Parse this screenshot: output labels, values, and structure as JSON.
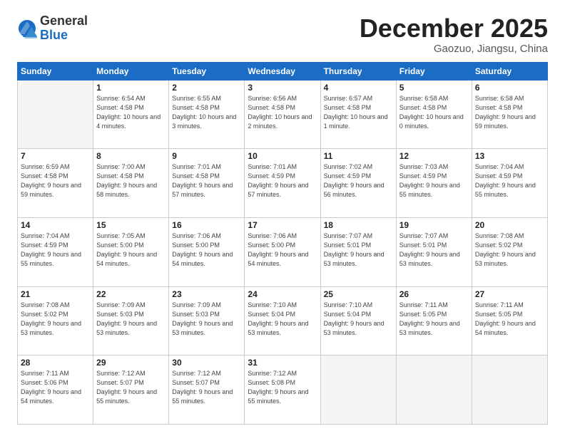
{
  "logo": {
    "general": "General",
    "blue": "Blue"
  },
  "header": {
    "month": "December 2025",
    "location": "Gaozuo, Jiangsu, China"
  },
  "weekdays": [
    "Sunday",
    "Monday",
    "Tuesday",
    "Wednesday",
    "Thursday",
    "Friday",
    "Saturday"
  ],
  "weeks": [
    [
      {
        "day": "",
        "sunrise": "",
        "sunset": "",
        "daylight": ""
      },
      {
        "day": "1",
        "sunrise": "Sunrise: 6:54 AM",
        "sunset": "Sunset: 4:58 PM",
        "daylight": "Daylight: 10 hours and 4 minutes."
      },
      {
        "day": "2",
        "sunrise": "Sunrise: 6:55 AM",
        "sunset": "Sunset: 4:58 PM",
        "daylight": "Daylight: 10 hours and 3 minutes."
      },
      {
        "day": "3",
        "sunrise": "Sunrise: 6:56 AM",
        "sunset": "Sunset: 4:58 PM",
        "daylight": "Daylight: 10 hours and 2 minutes."
      },
      {
        "day": "4",
        "sunrise": "Sunrise: 6:57 AM",
        "sunset": "Sunset: 4:58 PM",
        "daylight": "Daylight: 10 hours and 1 minute."
      },
      {
        "day": "5",
        "sunrise": "Sunrise: 6:58 AM",
        "sunset": "Sunset: 4:58 PM",
        "daylight": "Daylight: 10 hours and 0 minutes."
      },
      {
        "day": "6",
        "sunrise": "Sunrise: 6:58 AM",
        "sunset": "Sunset: 4:58 PM",
        "daylight": "Daylight: 9 hours and 59 minutes."
      }
    ],
    [
      {
        "day": "7",
        "sunrise": "Sunrise: 6:59 AM",
        "sunset": "Sunset: 4:58 PM",
        "daylight": "Daylight: 9 hours and 59 minutes."
      },
      {
        "day": "8",
        "sunrise": "Sunrise: 7:00 AM",
        "sunset": "Sunset: 4:58 PM",
        "daylight": "Daylight: 9 hours and 58 minutes."
      },
      {
        "day": "9",
        "sunrise": "Sunrise: 7:01 AM",
        "sunset": "Sunset: 4:58 PM",
        "daylight": "Daylight: 9 hours and 57 minutes."
      },
      {
        "day": "10",
        "sunrise": "Sunrise: 7:01 AM",
        "sunset": "Sunset: 4:59 PM",
        "daylight": "Daylight: 9 hours and 57 minutes."
      },
      {
        "day": "11",
        "sunrise": "Sunrise: 7:02 AM",
        "sunset": "Sunset: 4:59 PM",
        "daylight": "Daylight: 9 hours and 56 minutes."
      },
      {
        "day": "12",
        "sunrise": "Sunrise: 7:03 AM",
        "sunset": "Sunset: 4:59 PM",
        "daylight": "Daylight: 9 hours and 55 minutes."
      },
      {
        "day": "13",
        "sunrise": "Sunrise: 7:04 AM",
        "sunset": "Sunset: 4:59 PM",
        "daylight": "Daylight: 9 hours and 55 minutes."
      }
    ],
    [
      {
        "day": "14",
        "sunrise": "Sunrise: 7:04 AM",
        "sunset": "Sunset: 4:59 PM",
        "daylight": "Daylight: 9 hours and 55 minutes."
      },
      {
        "day": "15",
        "sunrise": "Sunrise: 7:05 AM",
        "sunset": "Sunset: 5:00 PM",
        "daylight": "Daylight: 9 hours and 54 minutes."
      },
      {
        "day": "16",
        "sunrise": "Sunrise: 7:06 AM",
        "sunset": "Sunset: 5:00 PM",
        "daylight": "Daylight: 9 hours and 54 minutes."
      },
      {
        "day": "17",
        "sunrise": "Sunrise: 7:06 AM",
        "sunset": "Sunset: 5:00 PM",
        "daylight": "Daylight: 9 hours and 54 minutes."
      },
      {
        "day": "18",
        "sunrise": "Sunrise: 7:07 AM",
        "sunset": "Sunset: 5:01 PM",
        "daylight": "Daylight: 9 hours and 53 minutes."
      },
      {
        "day": "19",
        "sunrise": "Sunrise: 7:07 AM",
        "sunset": "Sunset: 5:01 PM",
        "daylight": "Daylight: 9 hours and 53 minutes."
      },
      {
        "day": "20",
        "sunrise": "Sunrise: 7:08 AM",
        "sunset": "Sunset: 5:02 PM",
        "daylight": "Daylight: 9 hours and 53 minutes."
      }
    ],
    [
      {
        "day": "21",
        "sunrise": "Sunrise: 7:08 AM",
        "sunset": "Sunset: 5:02 PM",
        "daylight": "Daylight: 9 hours and 53 minutes."
      },
      {
        "day": "22",
        "sunrise": "Sunrise: 7:09 AM",
        "sunset": "Sunset: 5:03 PM",
        "daylight": "Daylight: 9 hours and 53 minutes."
      },
      {
        "day": "23",
        "sunrise": "Sunrise: 7:09 AM",
        "sunset": "Sunset: 5:03 PM",
        "daylight": "Daylight: 9 hours and 53 minutes."
      },
      {
        "day": "24",
        "sunrise": "Sunrise: 7:10 AM",
        "sunset": "Sunset: 5:04 PM",
        "daylight": "Daylight: 9 hours and 53 minutes."
      },
      {
        "day": "25",
        "sunrise": "Sunrise: 7:10 AM",
        "sunset": "Sunset: 5:04 PM",
        "daylight": "Daylight: 9 hours and 53 minutes."
      },
      {
        "day": "26",
        "sunrise": "Sunrise: 7:11 AM",
        "sunset": "Sunset: 5:05 PM",
        "daylight": "Daylight: 9 hours and 53 minutes."
      },
      {
        "day": "27",
        "sunrise": "Sunrise: 7:11 AM",
        "sunset": "Sunset: 5:05 PM",
        "daylight": "Daylight: 9 hours and 54 minutes."
      }
    ],
    [
      {
        "day": "28",
        "sunrise": "Sunrise: 7:11 AM",
        "sunset": "Sunset: 5:06 PM",
        "daylight": "Daylight: 9 hours and 54 minutes."
      },
      {
        "day": "29",
        "sunrise": "Sunrise: 7:12 AM",
        "sunset": "Sunset: 5:07 PM",
        "daylight": "Daylight: 9 hours and 55 minutes."
      },
      {
        "day": "30",
        "sunrise": "Sunrise: 7:12 AM",
        "sunset": "Sunset: 5:07 PM",
        "daylight": "Daylight: 9 hours and 55 minutes."
      },
      {
        "day": "31",
        "sunrise": "Sunrise: 7:12 AM",
        "sunset": "Sunset: 5:08 PM",
        "daylight": "Daylight: 9 hours and 55 minutes."
      },
      {
        "day": "",
        "sunrise": "",
        "sunset": "",
        "daylight": ""
      },
      {
        "day": "",
        "sunrise": "",
        "sunset": "",
        "daylight": ""
      },
      {
        "day": "",
        "sunrise": "",
        "sunset": "",
        "daylight": ""
      }
    ]
  ]
}
